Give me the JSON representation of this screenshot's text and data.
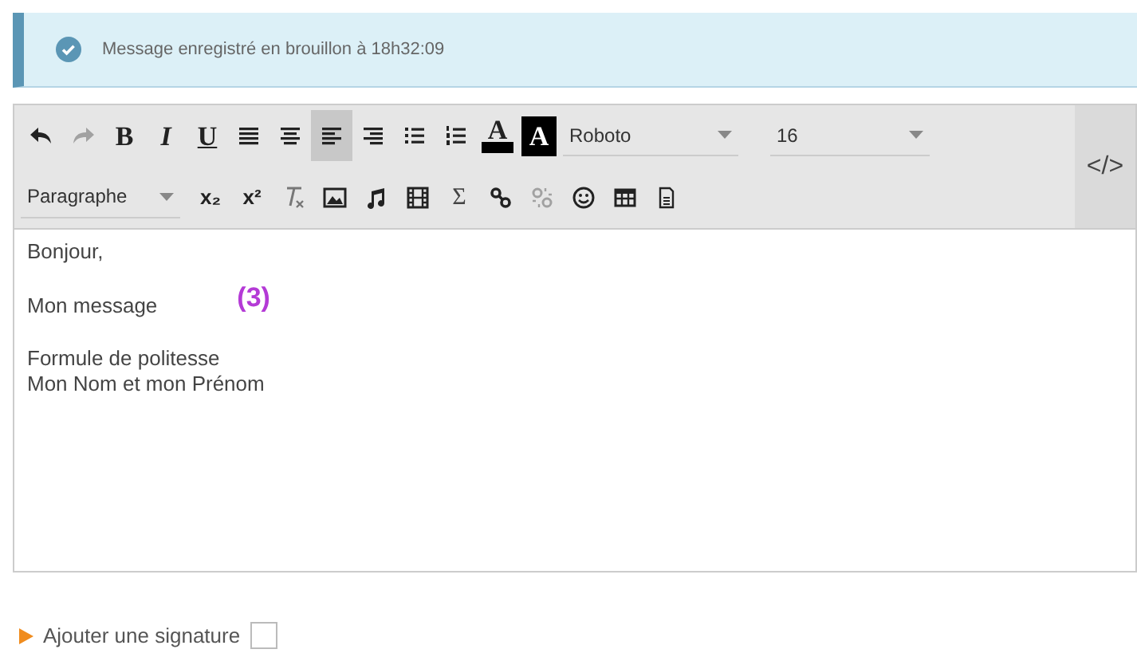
{
  "alert": {
    "message": "Message enregistré en brouillon à 18h32:09"
  },
  "toolbar": {
    "row_1": [
      {
        "kind": "undo",
        "disabled": false
      },
      {
        "kind": "redo",
        "disabled": true
      },
      {
        "kind": "bold",
        "label": "B"
      },
      {
        "kind": "italic",
        "label": "I"
      },
      {
        "kind": "underline",
        "label": "U"
      },
      {
        "kind": "justify",
        "selected": false
      },
      {
        "kind": "center",
        "selected": false
      },
      {
        "kind": "left",
        "selected": true
      },
      {
        "kind": "right",
        "selected": false
      },
      {
        "kind": "bullets"
      },
      {
        "kind": "numbers"
      },
      {
        "kind": "forecolor",
        "label": "A"
      },
      {
        "kind": "backcolor",
        "label": "A"
      }
    ],
    "font": "Roboto",
    "size": "16",
    "format": "Paragraphe",
    "source_label": "</>",
    "row_2": [
      {
        "kind": "script",
        "label": "x₂"
      },
      {
        "kind": "script",
        "label": "x²"
      },
      {
        "kind": "clear"
      },
      {
        "kind": "image"
      },
      {
        "kind": "music"
      },
      {
        "kind": "film"
      },
      {
        "kind": "symbol",
        "label": "Σ"
      },
      {
        "kind": "link",
        "disabled": false
      },
      {
        "kind": "unlink",
        "disabled": true
      },
      {
        "kind": "smiley"
      },
      {
        "kind": "table"
      },
      {
        "kind": "page"
      }
    ]
  },
  "content": [
    {
      "text": "Bonjour,"
    },
    {
      "text": "Mon message",
      "note": "(3)"
    },
    {
      "text": "Formule de politesse\nMon Nom et mon Prénom"
    }
  ],
  "signature": {
    "label": "Ajouter une signature",
    "checked": false
  }
}
